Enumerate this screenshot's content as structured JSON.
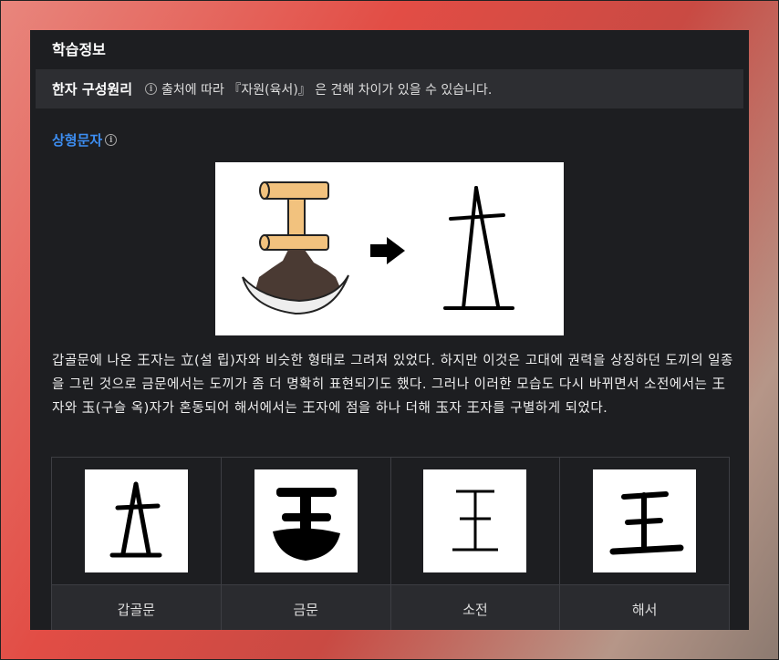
{
  "section_title": "학습정보",
  "principle": {
    "heading": "한자 구성원리",
    "note": "출처에 따라 『자원(육서)』 은 견해 차이가 있을 수 있습니다."
  },
  "character_type": "상형문자",
  "description": "갑골문에 나온 王자는 立(설 립)자와 비슷한 형태로 그려져 있었다. 하지만 이것은 고대에 권력을 상징하던 도끼의 일종을 그린 것으로 금문에서는 도끼가 좀 더 명확히 표현되기도 했다. 그러나 이러한 모습도 다시 바뀌면서 소전에서는 王자와 玉(구슬 옥)자가 혼동되어 해서에서는 王자에 점을 하나 더해 玉자 王자를 구별하게 되었다.",
  "scripts": [
    {
      "label": "갑골문"
    },
    {
      "label": "금문"
    },
    {
      "label": "소전"
    },
    {
      "label": "해서"
    }
  ],
  "icons": {
    "info": "info-circle-icon",
    "arrow": "arrow-right-icon"
  }
}
